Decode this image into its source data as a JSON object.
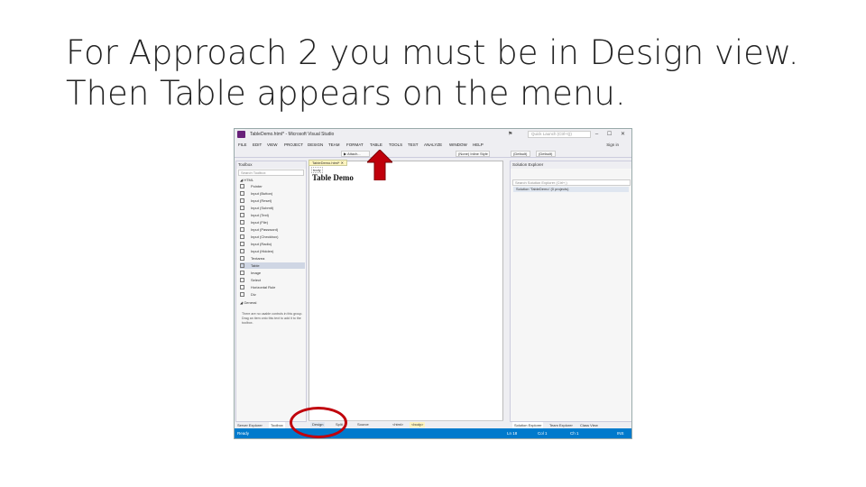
{
  "slide": {
    "title_line1": "For Approach 2 you must be in Design view.",
    "title_line2": "Then Table appears on the menu."
  },
  "window": {
    "title": "TableDemo.html* - Microsoft Visual Studio",
    "quick_launch": "Quick Launch (Ctrl+Q)",
    "sign_in": "Sign in",
    "controls": "– ☐ ✕"
  },
  "menu": [
    "FILE",
    "EDIT",
    "VIEW",
    "PROJECT",
    "DESIGN",
    "TEAM",
    "FORMAT",
    "TABLE",
    "TOOLS",
    "TEST",
    "ANALYZE",
    "WINDOW",
    "HELP"
  ],
  "toolbar": {
    "attach": "▶ Attach...",
    "style": "(None) Inline Style",
    "browser": "(Default)",
    "target": "(Default)"
  },
  "toolbox": {
    "header": "Toolbox",
    "search": "Search Toolbox",
    "group": "◢ HTML",
    "items": [
      "Pointer",
      "Input (Button)",
      "Input (Reset)",
      "Input (Submit)",
      "Input (Text)",
      "Input (File)",
      "Input (Password)",
      "Input (Checkbox)",
      "Input (Radio)",
      "Input (Hidden)",
      "Textarea",
      "Table",
      "Image",
      "Select",
      "Horizontal Rule",
      "Div"
    ],
    "selected_index": 11,
    "group2": "◢ General",
    "hint": "There are no usable controls in this group. Drag an item onto this text to add it to the toolbox.",
    "tab_server": "Server Explorer",
    "tab_toolbox": "Toolbox"
  },
  "editor": {
    "tab": "TableDemo.html* ✕",
    "body_tag": "body",
    "heading": "Table Demo",
    "view_design": "Design",
    "view_split": "Split",
    "view_source": "Source",
    "tag1": "<html>",
    "tag2": "<body>"
  },
  "solution": {
    "header": "Solution Explorer",
    "search": "Search Solution Explorer (Ctrl+;)",
    "row": "Solution 'TableDemo' (0 projects)",
    "tab1": "Solution Explorer",
    "tab2": "Team Explorer",
    "tab3": "Class View"
  },
  "status": {
    "ready": "Ready",
    "ln": "Ln 18",
    "col": "Col 1",
    "ch": "Ch 1",
    "ins": "INS"
  }
}
